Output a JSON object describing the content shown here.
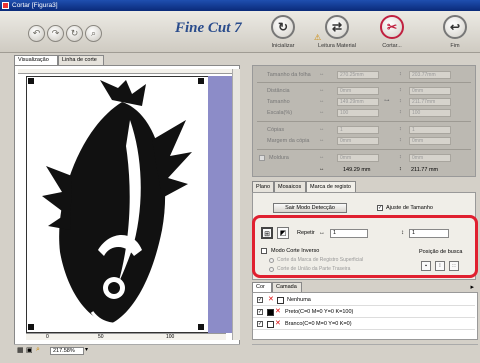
{
  "window": {
    "title": "Cortar [Figura3]"
  },
  "app": {
    "logo": "Fine Cut 7"
  },
  "toolbar": {
    "inicializar": "Inicializar",
    "leitura": "Leitura Material",
    "cortar": "Cortar...",
    "fim": "Fim"
  },
  "view_tabs": [
    "Visualização",
    "Linha de corte"
  ],
  "settings": {
    "tamanho_folha": {
      "label": "Tamanho da folha",
      "w": "270.25mm",
      "h": "203.77mm"
    },
    "distancia": {
      "label": "Distância",
      "w": "0mm",
      "h": "0mm"
    },
    "tamanho": {
      "label": "Tamanho",
      "w": "149.29mm",
      "h": "211.77mm"
    },
    "escala": {
      "label": "Escala(%)",
      "w": "100",
      "h": "100"
    },
    "copias": {
      "label": "Cópias",
      "w": "1",
      "h": "1"
    },
    "margem": {
      "label": "Margem da cópia",
      "w": "0mm",
      "h": "0mm"
    },
    "moldura": {
      "label": "Moldura",
      "w": "0mm",
      "h": "0mm"
    },
    "totals": {
      "w": "149.29 mm",
      "h": "211.77 mm"
    }
  },
  "panel_tabs": [
    "Plano",
    "Mosaicos",
    "Marca de registo"
  ],
  "registo": {
    "sair_btn": "Sair Modo Detecção",
    "ajuste_label": "Ajuste de Tamanho",
    "repetir_label": "Repetir",
    "repetir_x": "1",
    "repetir_y": "1",
    "modo_corte": "Modo Corte Inverso",
    "opt1": "Corte da Marca de Registro Superficial",
    "opt2": "Corte de União da Parte Traseira",
    "posicao_busca": "Posição de busca"
  },
  "layer_tabs": [
    "Cor",
    "Camada"
  ],
  "layers": [
    {
      "label": "Nenhuma",
      "color": "#ffffff"
    },
    {
      "label": "Preto(C=0 M=0 Y=0 K=100)",
      "color": "#000000"
    },
    {
      "label": "Branco(C=0 M=0 Y=0 K=0)",
      "color": "#ffffff"
    }
  ],
  "ruler": {
    "left": "0",
    "mid": "50",
    "right": "100"
  },
  "status": {
    "zoom": "217.58%"
  },
  "colors": {
    "highlight": "#e02030",
    "sheet_band": "#8c8cc8"
  }
}
